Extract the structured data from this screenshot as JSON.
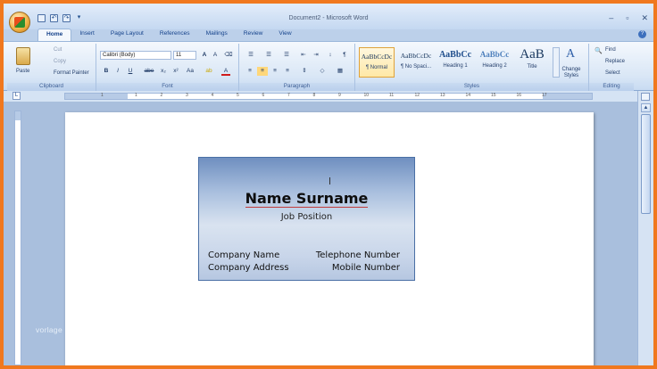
{
  "window": {
    "title": "Document2 - Microsoft Word",
    "controls": [
      "–",
      "▫",
      "✕"
    ]
  },
  "quick_access": [
    "💾",
    "↶",
    "↷",
    "▾"
  ],
  "tabs": [
    "Home",
    "Insert",
    "Page Layout",
    "References",
    "Mailings",
    "Review",
    "View"
  ],
  "active_tab": "Home",
  "ribbon": {
    "clipboard": {
      "label": "Clipboard",
      "paste": "Paste",
      "cut": "Cut",
      "copy": "Copy",
      "format_painter": "Format Painter"
    },
    "font": {
      "label": "Font",
      "font_name": "Calibri (Body)",
      "font_size": "11",
      "buttons": [
        "B",
        "I",
        "U",
        "abe",
        "x₂",
        "x²",
        "Aa"
      ]
    },
    "paragraph": {
      "label": "Paragraph"
    },
    "styles": {
      "label": "Styles",
      "items": [
        {
          "sample": "AaBbCcDc",
          "name": "¶ Normal"
        },
        {
          "sample": "AaBbCcDc",
          "name": "¶ No Spaci..."
        },
        {
          "sample": "AaBbCc",
          "name": "Heading 1"
        },
        {
          "sample": "AaBbCc",
          "name": "Heading 2"
        },
        {
          "sample": "AaB",
          "name": "Title"
        }
      ],
      "change_styles": "Change Styles"
    },
    "editing": {
      "label": "Editing",
      "find": "Find",
      "replace": "Replace",
      "select": "Select"
    }
  },
  "ruler_numbers": [
    "1",
    "1",
    "2",
    "3",
    "4",
    "5",
    "6",
    "7",
    "8",
    "9",
    "10",
    "11",
    "12",
    "13",
    "14",
    "15",
    "16",
    "17"
  ],
  "card": {
    "name": "Name Surname",
    "job": "Job Position",
    "company_name": "Company Name",
    "company_address": "Company Address",
    "telephone": "Telephone Number",
    "mobile": "Mobile Number"
  },
  "watermark": "vorlage"
}
